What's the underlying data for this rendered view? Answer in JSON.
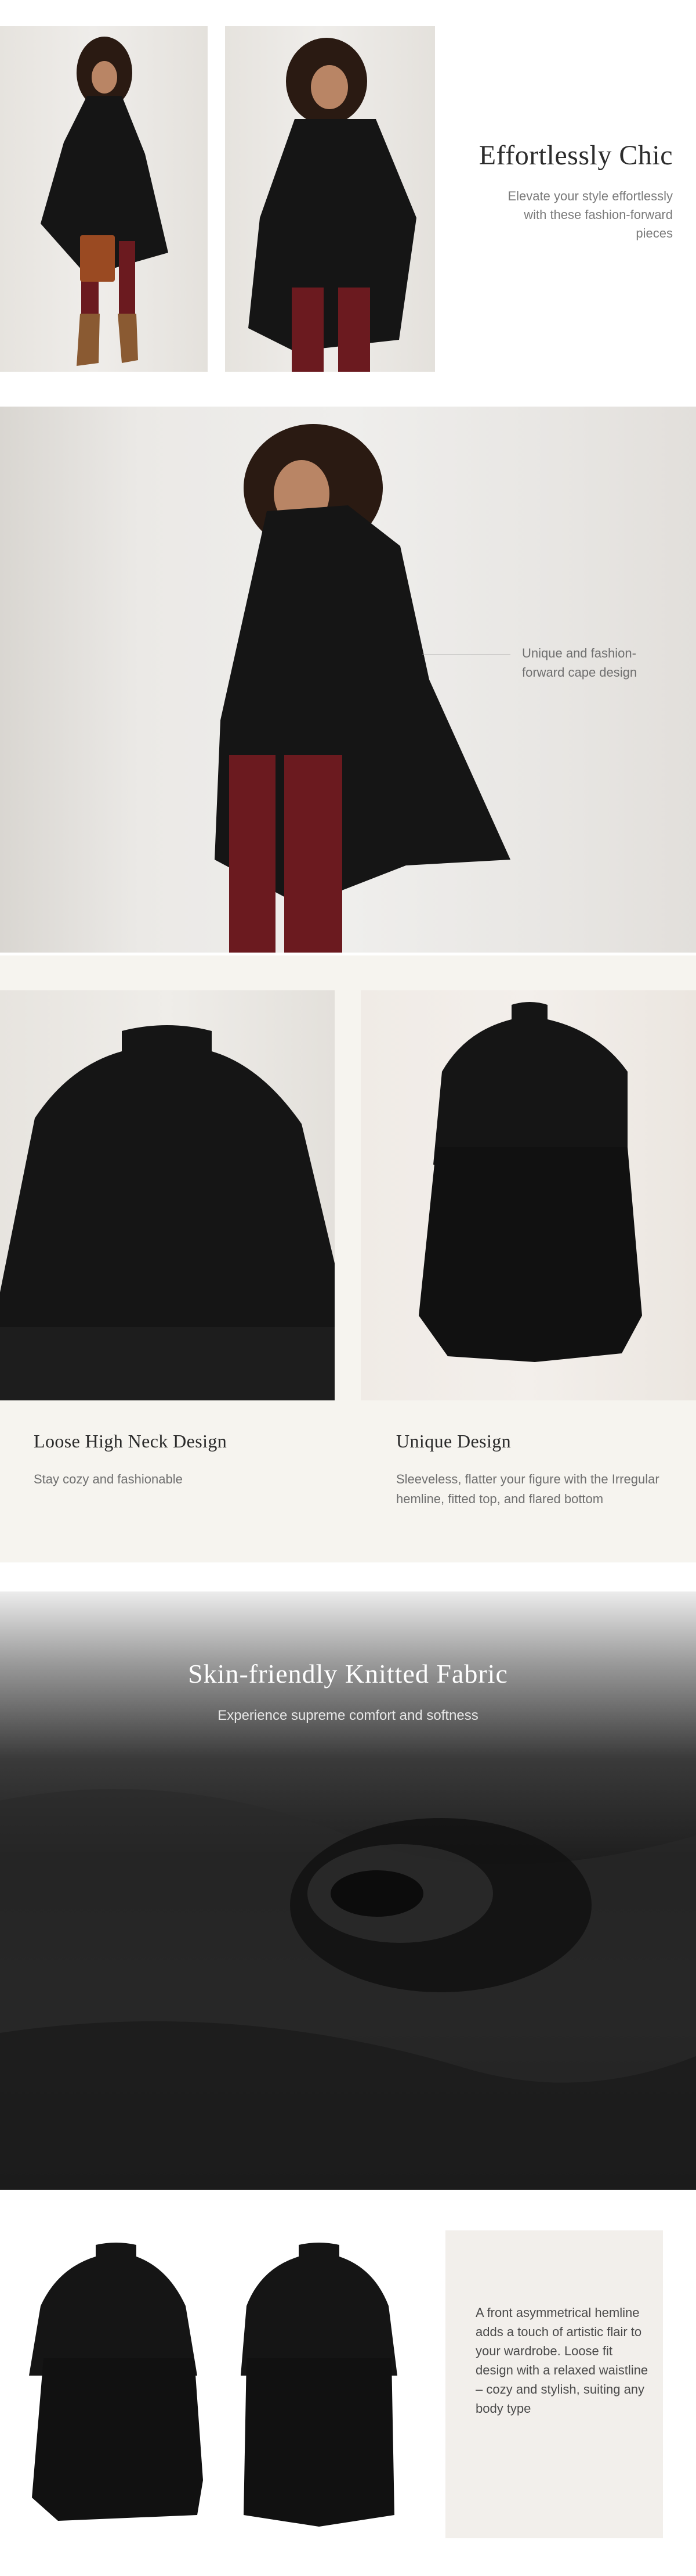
{
  "section_chic": {
    "title": "Effortlessly Chic",
    "text": "Elevate your style effortlessly with these fashion-forward pieces"
  },
  "section_cape": {
    "note": "Unique and fashion-forward cape design"
  },
  "section_features": {
    "features": [
      {
        "title": "Loose High Neck Design",
        "text": "Stay cozy and fashionable"
      },
      {
        "title": "Unique Design",
        "text": "Sleeveless, flatter your figure with the Irregular hemline, fitted top, and flared bottom"
      }
    ]
  },
  "section_fabric": {
    "title": "Skin-friendly Knitted Fabric",
    "subtitle": "Experience supreme comfort and softness"
  },
  "section_fit": {
    "text": "A front asymmetrical hemline adds a touch of artistic flair to your wardrobe. Loose fit design with a relaxed waistline –  cozy and stylish, suiting any body type"
  },
  "colors": {
    "garment": "#151515",
    "pants": "#6b1a1f",
    "boots": "#8a5a32",
    "bag": "#9a4a22",
    "features_bg": "#f6f4ef",
    "fit_box_bg": "#f2efeb",
    "title_text": "#2c2c2c",
    "body_text": "#7a7a7a"
  }
}
